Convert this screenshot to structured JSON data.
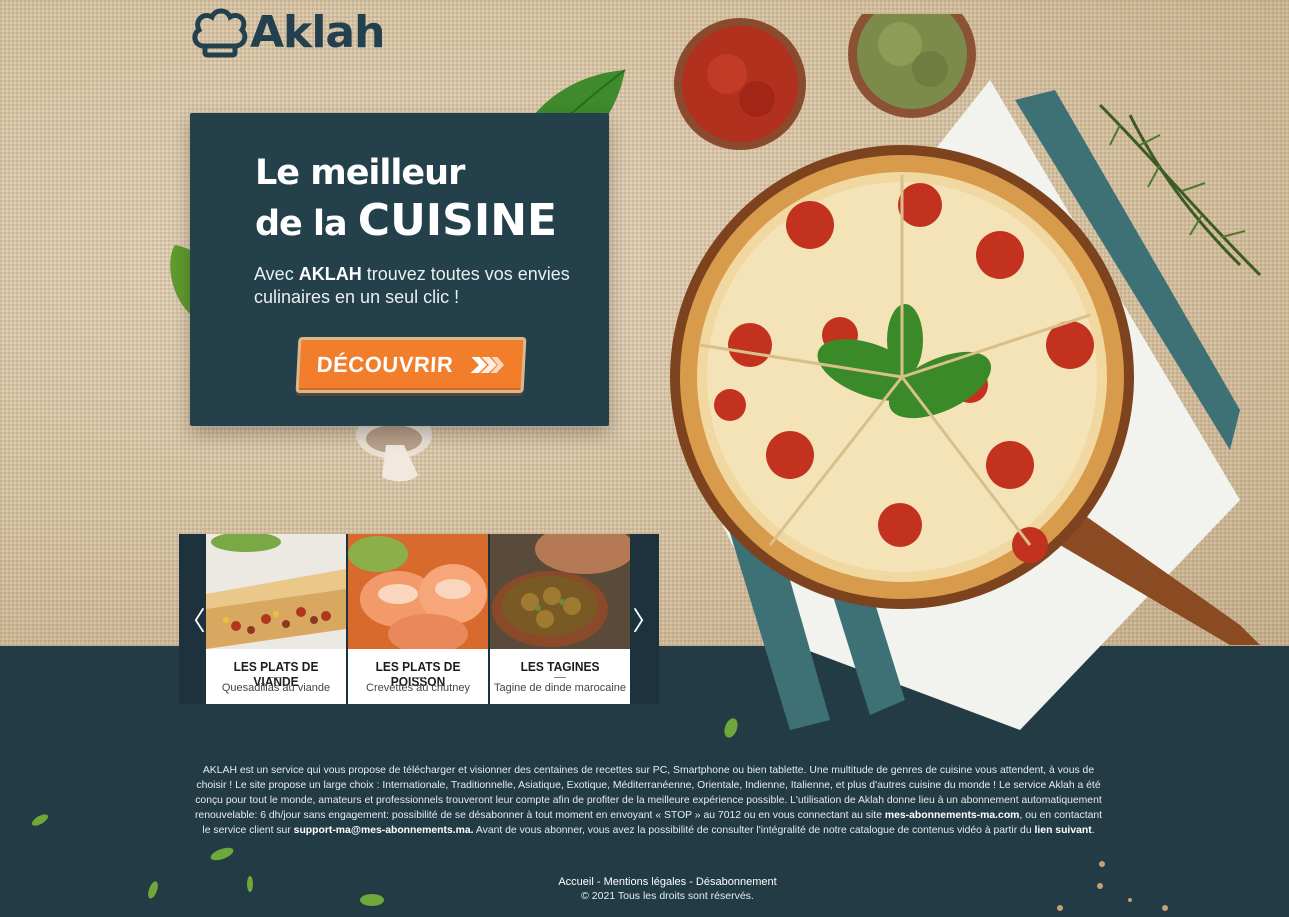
{
  "brand": {
    "name": "Aklah"
  },
  "hero": {
    "title_line1": "Le meilleur",
    "title_line2_prefix": "de la ",
    "title_line2_emphasis": "CUISINE",
    "subtitle_prefix": "Avec ",
    "subtitle_brand": "AKLAH",
    "subtitle_rest": " trouvez toutes vos envies culinaires en un seul clic !",
    "cta_label": "DÉCOUVRIR"
  },
  "carousel": {
    "prev_label": "〈",
    "next_label": "〉",
    "cards": [
      {
        "title": "LES PLATS DE VIANDE",
        "subtitle": "Quesadillas au viande"
      },
      {
        "title": "LES PLATS DE POISSON",
        "subtitle": "Crevettes au chutney"
      },
      {
        "title": "LES TAGINES",
        "subtitle": "Tagine de dinde marocaine"
      }
    ]
  },
  "footer": {
    "about_part1": "AKLAH est un service qui vous propose de télécharger et visionner des centaines de recettes sur PC, Smartphone ou bien tablette. Une multitude de genres de cuisine vous attendent, à vous de choisir ! Le site propose un large choix : Internationale, Traditionnelle, Asiatique, Exotique, Méditerranéenne, Orientale, Indienne, Italienne, et plus d'autres cuisine du monde ! Le service Aklah a été conçu pour tout le monde, amateurs et professionnels trouveront leur compte afin de profiter de la meilleure expérience possible. L'utilisation de Aklah donne lieu à un abonnement automatiquement renouvelable: 6 dh/jour sans engagement: possibilité de se désabonner à tout moment en envoyant « STOP » au 7012 ou en vous connectant au site ",
    "about_site": "mes-abonnements-ma.com",
    "about_part2": ", ou en contactant le service client sur ",
    "about_email": "support-ma@mes-abonnements.ma.",
    "about_part3": " Avant de vous abonner, vous avez la possibilité de consulter l'intégralité de notre catalogue de contenus vidéo à partir du ",
    "about_link": "lien suivant",
    "about_end": ".",
    "links": {
      "home": "Accueil",
      "sep1": " - ",
      "legal": "Mentions légales",
      "sep2": " - ",
      "unsubscribe": "Désabonnement"
    },
    "copyright": "© 2021 Tous les droits sont réservés."
  },
  "colors": {
    "panel": "#24404b",
    "accent": "#f27d2a",
    "footer_bg": "#233b45",
    "logo": "#22404d"
  }
}
